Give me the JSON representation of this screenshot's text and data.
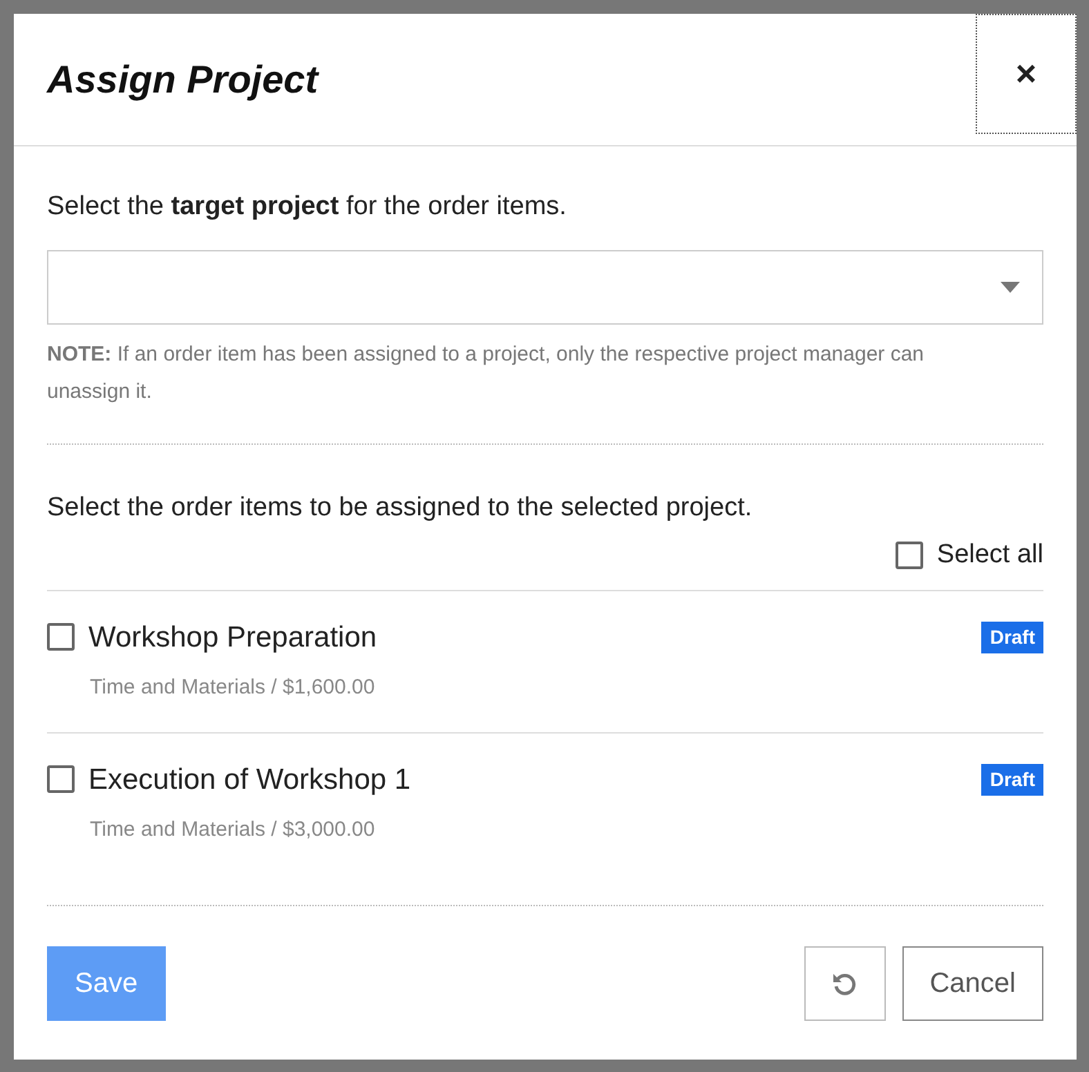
{
  "dialog": {
    "title": "Assign Project",
    "close": "×"
  },
  "project_prompt": "Select the **target project** for the order items.",
  "note": "**NOTE:** If an order item has been assigned to a project, only the respective project manager can unassign it.",
  "items_prompt": "Select the order items to be assigned to the selected project.",
  "select_all": {
    "label": "Select all",
    "checked": false
  },
  "items": [
    {
      "name": "Workshop Preparation",
      "detail": "Time and Materials / $1,600.00",
      "status": "Draft",
      "checked": false
    },
    {
      "name": "Execution of Workshop 1",
      "detail": "Time and Materials / $3,000.00",
      "status": "Draft",
      "checked": false
    }
  ],
  "buttons": {
    "save": {
      "label": "Save",
      "disabled": true
    },
    "cancel": {
      "label": "Cancel"
    }
  }
}
